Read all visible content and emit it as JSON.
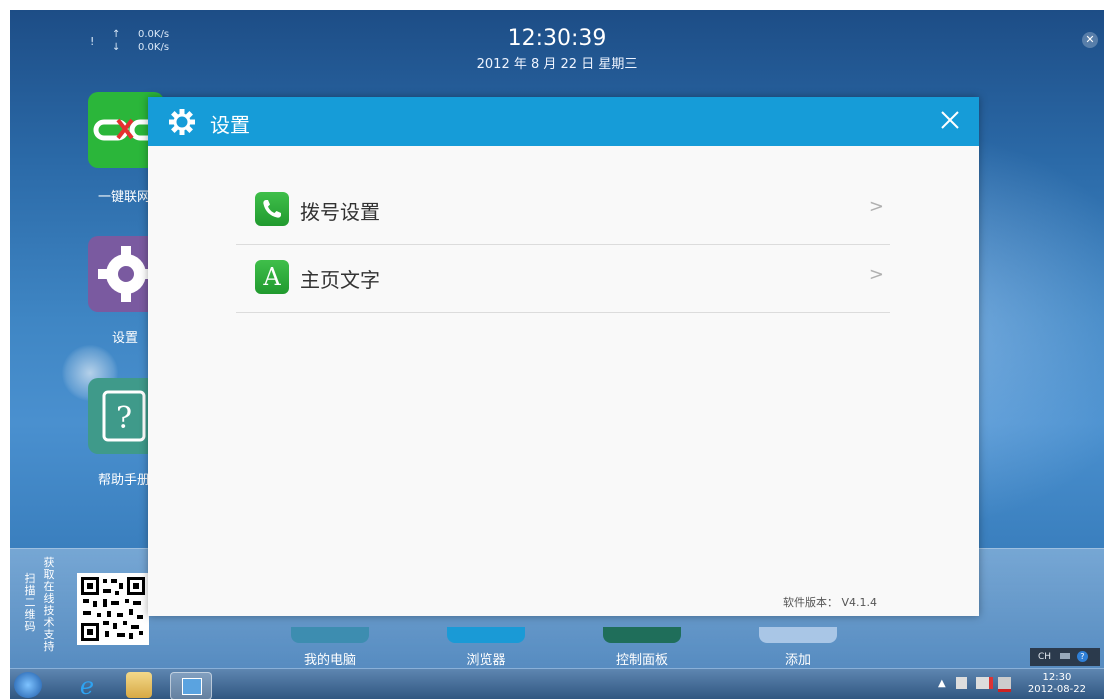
{
  "status": {
    "bang": "!",
    "up_arrow": "↑",
    "down_arrow": "↓",
    "up_speed": "0.0K/s",
    "down_speed": "0.0K/s",
    "time": "12:30:39",
    "date": "2012 年 8 月 22 日  星期三"
  },
  "desktop": {
    "tiles": [
      {
        "label": "一键联网",
        "color": "#2bb63a"
      },
      {
        "label": "设置",
        "color": "#7a5aa0"
      },
      {
        "label": "帮助手册",
        "color": "#3f9a8a"
      }
    ],
    "scan_col1": "扫描二维码",
    "scan_col2": "获取在线技术支持",
    "dock": [
      {
        "label": "我的电脑",
        "color": "#3d8db0"
      },
      {
        "label": "浏览器",
        "color": "#1a9ad6"
      },
      {
        "label": "控制面板",
        "color": "#1f6e5a"
      },
      {
        "label": "添加",
        "color": "#a9c6e6"
      }
    ]
  },
  "dialog": {
    "title": "设置",
    "items": [
      {
        "label": "拨号设置",
        "icon": "phone-icon",
        "chevron": ">"
      },
      {
        "label": "主页文字",
        "icon": "letter-a-icon",
        "icon_text": "A",
        "chevron": ">"
      }
    ],
    "version": "软件版本： V4.1.4"
  },
  "taskbar": {
    "lang": "CH",
    "tray_time": "12:30",
    "tray_date": "2012-08-22"
  }
}
